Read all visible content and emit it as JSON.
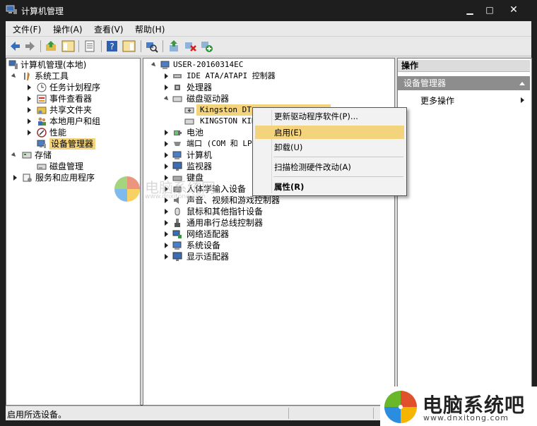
{
  "window": {
    "title": "计算机管理"
  },
  "menu": {
    "items": [
      "文件(F)",
      "操作(A)",
      "查看(V)",
      "帮助(H)"
    ]
  },
  "toolbar": {
    "icons": [
      "back-icon",
      "forward-icon",
      "up-icon",
      "show-tree-icon",
      "properties-icon",
      "help-icon",
      "show-action-icon",
      "scan-hardware-icon",
      "update-driver-icon",
      "uninstall-icon",
      "enable-device-icon"
    ]
  },
  "left_tree": {
    "root": "计算机管理(本地)",
    "system_tools": "系统工具",
    "task_scheduler": "任务计划程序",
    "event_viewer": "事件查看器",
    "shared_folders": "共享文件夹",
    "local_users": "本地用户和组",
    "performance": "性能",
    "device_manager": "设备管理器",
    "storage": "存储",
    "disk_management": "磁盘管理",
    "services_apps": "服务和应用程序"
  },
  "device_tree": {
    "computer": "USER-20160314EC",
    "ide": "IDE ATA/ATAPI 控制器",
    "cpu": "处理器",
    "disk_drives": "磁盘驱动器",
    "disk1": "Kingston DT",
    "disk2": "KINGSTON KIN",
    "battery": "电池",
    "ports": "端口 (COM 和 LPT)",
    "computer_node": "计算机",
    "monitors": "监视器",
    "keyboards": "键盘",
    "hid": "人体学输入设备",
    "sound": "声音、视频和游戏控制器",
    "mice": "鼠标和其他指针设备",
    "usb": "通用串行总线控制器",
    "network": "网络适配器",
    "system_devices": "系统设备",
    "display": "显示适配器"
  },
  "actions": {
    "header": "操作",
    "section": "设备管理器",
    "more": "更多操作"
  },
  "context_menu": {
    "update_driver": "更新驱动程序软件(P)...",
    "enable": "启用(E)",
    "uninstall": "卸载(U)",
    "scan": "扫描检测硬件改动(A)",
    "properties": "属性(R)"
  },
  "status": {
    "text": "启用所选设备。"
  },
  "watermark": {
    "text": "电脑系统吧",
    "url": "www.dnxitong.com",
    "faint_text": "电脑系统网",
    "faint_url": "www.dnxitong.com"
  },
  "colors": {
    "selection": "#f3d37b",
    "action_section": "#8d8d8d",
    "title_bar": "#1e1e1e"
  }
}
